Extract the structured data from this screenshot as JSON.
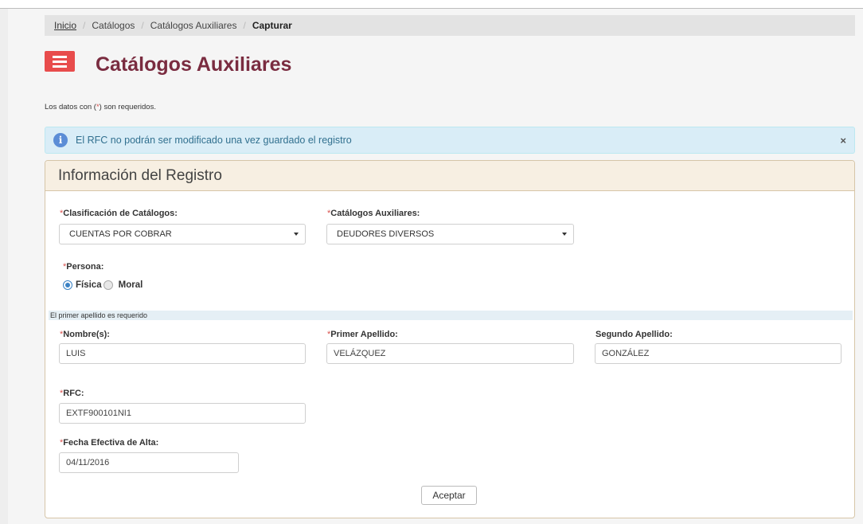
{
  "breadcrumb": {
    "home": "Inicio",
    "separator": "/",
    "level1": "Catálogos",
    "level2": "Catálogos Auxiliares",
    "current": "Capturar"
  },
  "header": {
    "title": "Catálogos Auxiliares",
    "menu_icon": "hamburger-icon"
  },
  "required_note": {
    "prefix": "Los datos con (",
    "star": "*",
    "suffix": ") son requeridos."
  },
  "alert": {
    "icon": "info-icon",
    "text": "El RFC no podrán ser modificado una vez guardado el registro",
    "close": "×"
  },
  "panel": {
    "title": "Información del Registro"
  },
  "form": {
    "required_mark": "*",
    "clasificacion": {
      "label": "Clasificación de Catálogos:",
      "value": "CUENTAS POR COBRAR"
    },
    "catalogos": {
      "label": "Catálogos Auxiliares:",
      "value": "DEUDORES DIVERSOS"
    },
    "persona": {
      "label": "Persona:",
      "options": [
        "Física",
        "Moral"
      ],
      "selected": "Física"
    },
    "hint": "El primer apellido es requerido",
    "nombre": {
      "label": "Nombre(s):",
      "value": "LUIS"
    },
    "primer_apellido": {
      "label": "Primer Apellido:",
      "value": "VELÁZQUEZ"
    },
    "segundo_apellido": {
      "label": "Segundo Apellido:",
      "value": "GONZÁLEZ"
    },
    "rfc": {
      "label": "RFC:",
      "value": "EXTF900101NI1"
    },
    "fecha": {
      "label": "Fecha Efectiva de Alta:",
      "value": "04/11/2016"
    },
    "submit": "Aceptar"
  },
  "colors": {
    "title": "#7a2c40",
    "menu_button": "#e84c4c",
    "alert_bg": "#d9edf7",
    "panel_header_bg": "#f7efe2",
    "required_star": "#d9534f"
  }
}
